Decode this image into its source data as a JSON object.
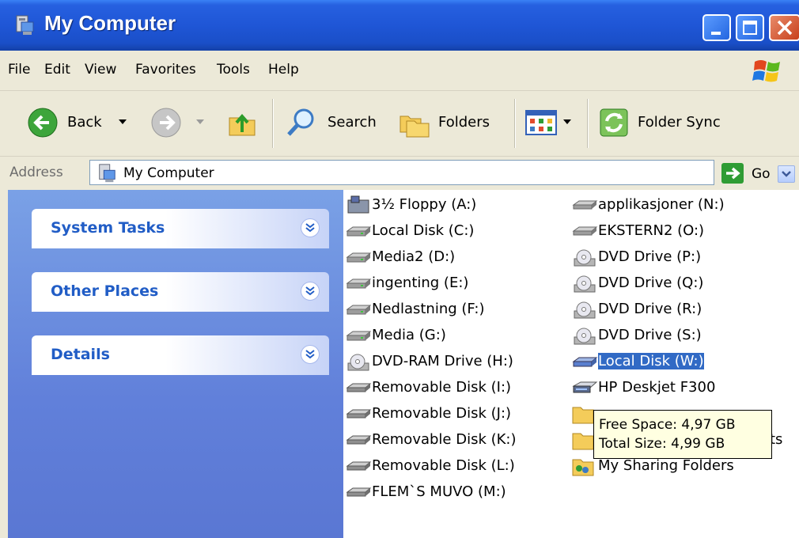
{
  "window": {
    "title": "My Computer"
  },
  "menu": {
    "file": "File",
    "edit": "Edit",
    "view": "View",
    "favorites": "Favorites",
    "tools": "Tools",
    "help": "Help"
  },
  "toolbar": {
    "back": "Back",
    "search": "Search",
    "folders": "Folders",
    "folder_sync": "Folder Sync"
  },
  "address": {
    "label": "Address",
    "value": "My Computer",
    "go": "Go"
  },
  "tasks": {
    "system": "System Tasks",
    "other": "Other Places",
    "details": "Details"
  },
  "files": {
    "col1": [
      {
        "label": "3½ Floppy (A:)",
        "icon": "floppy-icon"
      },
      {
        "label": "Local Disk (C:)",
        "icon": "hard-disk-icon"
      },
      {
        "label": "Media2 (D:)",
        "icon": "hard-disk-icon"
      },
      {
        "label": "ingenting (E:)",
        "icon": "hard-disk-icon"
      },
      {
        "label": "Nedlastning (F:)",
        "icon": "hard-disk-icon"
      },
      {
        "label": "Media (G:)",
        "icon": "hard-disk-icon"
      },
      {
        "label": "DVD-RAM Drive (H:)",
        "icon": "dvd-drive-icon"
      },
      {
        "label": "Removable Disk (I:)",
        "icon": "removable-disk-icon"
      },
      {
        "label": "Removable Disk (J:)",
        "icon": "removable-disk-icon"
      },
      {
        "label": "Removable Disk (K:)",
        "icon": "removable-disk-icon"
      },
      {
        "label": "Removable Disk (L:)",
        "icon": "removable-disk-icon"
      },
      {
        "label": "FLEM`S MUVO (M:)",
        "icon": "removable-disk-icon"
      }
    ],
    "col2": [
      {
        "label": "applikasjoner (N:)",
        "icon": "network-drive-icon"
      },
      {
        "label": "EKSTERN2 (O:)",
        "icon": "network-drive-icon"
      },
      {
        "label": "DVD Drive (P:)",
        "icon": "dvd-drive-icon"
      },
      {
        "label": "DVD Drive (Q:)",
        "icon": "dvd-drive-icon"
      },
      {
        "label": "DVD Drive (R:)",
        "icon": "dvd-drive-icon"
      },
      {
        "label": "DVD Drive (S:)",
        "icon": "dvd-drive-icon"
      },
      {
        "label": "Local Disk (W:)",
        "icon": "hard-disk-icon",
        "selected": true
      },
      {
        "label": "HP Deskjet F300",
        "icon": "scanner-icon"
      },
      {
        "label": "",
        "icon": "folder-icon"
      },
      {
        "label": "ts",
        "icon": "folder-icon"
      },
      {
        "label": "My Sharing Folders",
        "icon": "sharing-folder-icon"
      }
    ]
  },
  "tooltip": {
    "free": "Free Space: 4,97 GB",
    "total": "Total Size: 4,99 GB"
  }
}
